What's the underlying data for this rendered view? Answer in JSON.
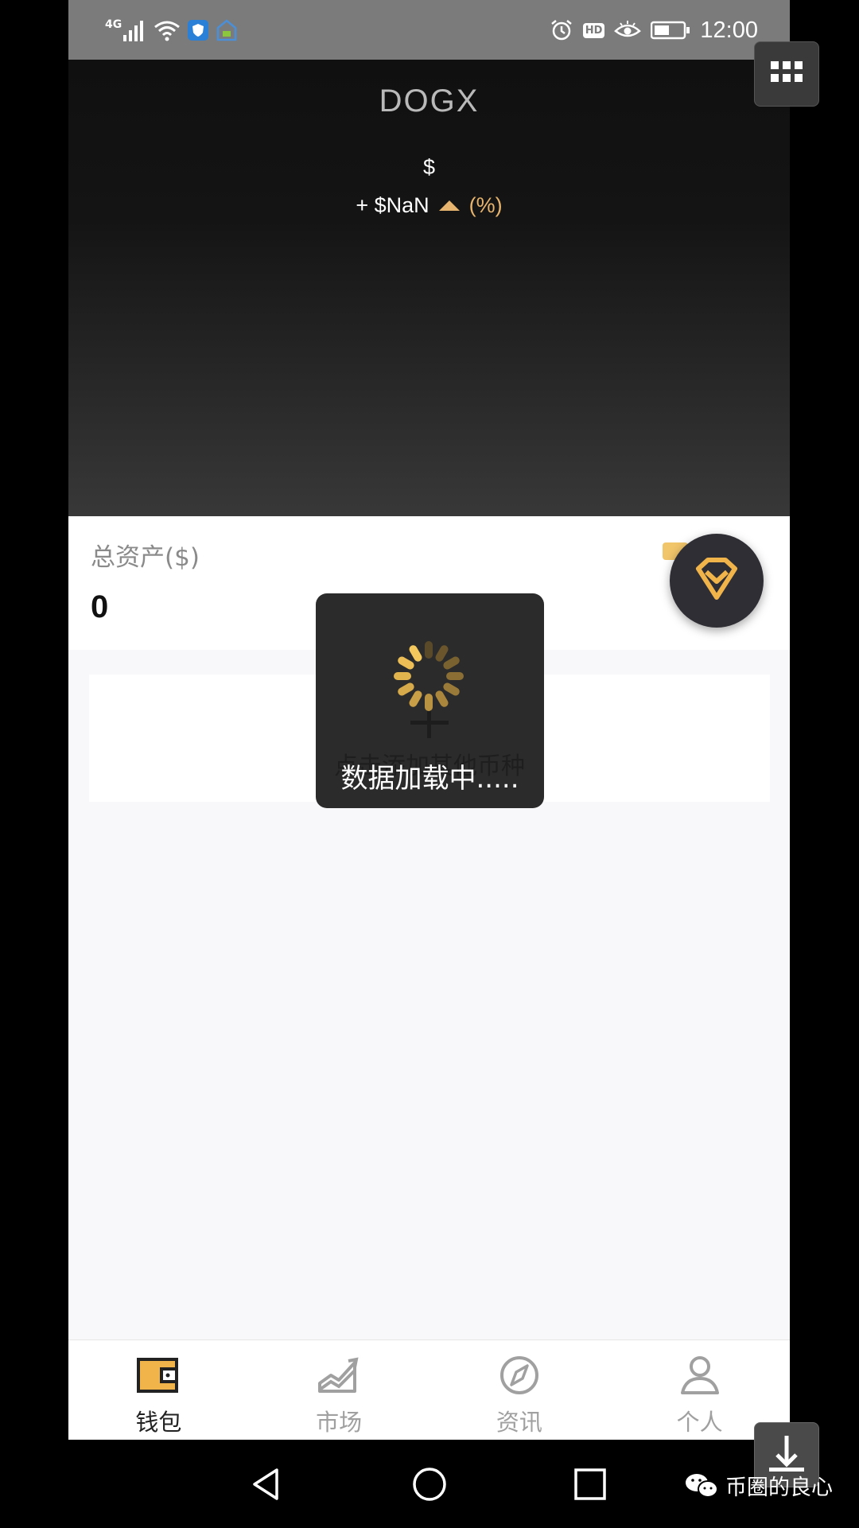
{
  "status_bar": {
    "network": "4G",
    "hd": "HD",
    "time": "12:00"
  },
  "header": {
    "title": "DOGX",
    "price": "$",
    "change": "+ $NaN",
    "change_pct": "(%)"
  },
  "assets": {
    "label": "总资产($)",
    "value": "0"
  },
  "add_card": {
    "text": "点击添加其他币种"
  },
  "loading": {
    "text": "数据加载中....."
  },
  "tabs": [
    {
      "label": "钱包",
      "icon": "wallet-icon",
      "active": true
    },
    {
      "label": "市场",
      "icon": "market-chart-icon",
      "active": false
    },
    {
      "label": "资讯",
      "icon": "compass-icon",
      "active": false
    },
    {
      "label": "个人",
      "icon": "person-icon",
      "active": false
    }
  ],
  "watermark": {
    "text": "币圈的良心"
  },
  "colors": {
    "accent": "#e6b46e",
    "header_dark": "#141414",
    "badge_bg": "#2e2e34"
  }
}
